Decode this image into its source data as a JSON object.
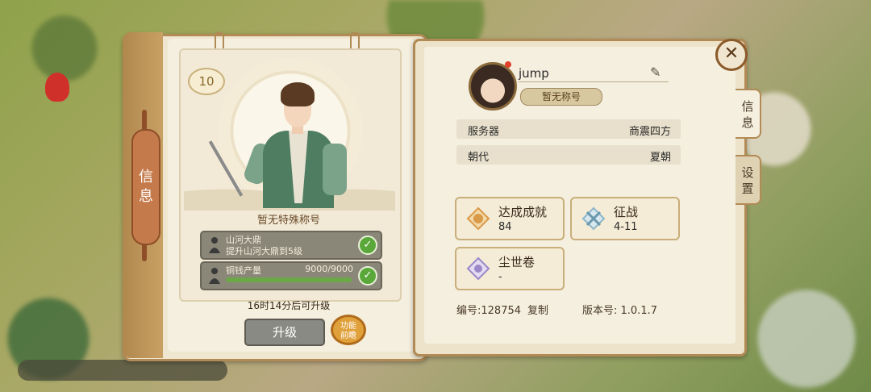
{
  "sidebar_tab": {
    "label_top": "信",
    "label_bottom": "息"
  },
  "character": {
    "level": "10",
    "title": "暂无特殊称号"
  },
  "tasks": [
    {
      "title": "山河大鼎",
      "desc": "提升山河大鼎到5级",
      "done": true
    },
    {
      "title": "铜钱产量",
      "amount": "9000/9000",
      "progress": 1.0,
      "done": true
    }
  ],
  "upgrade": {
    "timer_text": "16时14分后可升级",
    "button_label": "升级",
    "preview_label_1": "功能",
    "preview_label_2": "前瞻"
  },
  "profile": {
    "username": "jump",
    "title_badge": "暂无称号"
  },
  "info_rows": [
    {
      "key": "服务器",
      "value": "商震四方"
    },
    {
      "key": "朝代",
      "value": "夏朝"
    }
  ],
  "stat_cards": [
    {
      "label": "达成成就",
      "value": "84",
      "icon": "phoenix-icon",
      "color": "#d99a4a"
    },
    {
      "label": "征战",
      "value": "4-11",
      "icon": "crossed-swords-icon",
      "color": "#8fb6c8"
    },
    {
      "label": "尘世卷",
      "value": "-",
      "icon": "lotus-icon",
      "color": "#9b88c8"
    }
  ],
  "footer": {
    "id_label": "编号:128754",
    "copy_label": "复制",
    "version_label": "版本号: 1.0.1.7"
  },
  "right_tabs": [
    {
      "label_top": "信",
      "label_bottom": "息",
      "active": true
    },
    {
      "label_top": "设",
      "label_bottom": "置",
      "active": false
    }
  ]
}
